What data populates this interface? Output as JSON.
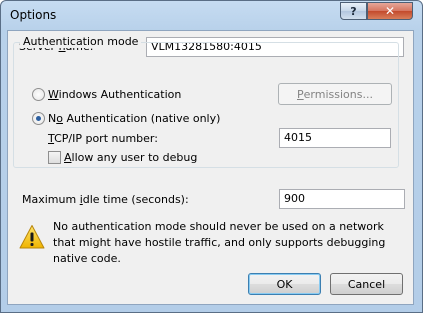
{
  "window": {
    "title": "Options",
    "help_label": "?",
    "close_label": "✕"
  },
  "server": {
    "label_pre": "Server ",
    "label_u": "n",
    "label_post": "ame:",
    "value": "VLM13281580:4015"
  },
  "auth": {
    "group_title": "Authentication mode",
    "windows_auth": {
      "label_u": "W",
      "label_post": "indows Authentication",
      "selected": false
    },
    "permissions_button": {
      "label_u": "P",
      "label_post": "ermissions...",
      "enabled": false
    },
    "no_auth": {
      "label_pre": "N",
      "label_u": "o",
      "label_post": " Authentication (native only)",
      "selected": true
    },
    "port": {
      "label_u": "T",
      "label_post": "CP/IP port number:",
      "value": "4015"
    },
    "allow_any": {
      "label_u": "A",
      "label_post": "llow any user to debug",
      "checked": false
    }
  },
  "idle": {
    "label_pre": "Maximum ",
    "label_u": "i",
    "label_post": "dle time (seconds):",
    "value": "900"
  },
  "warning": {
    "icon": "warning-icon",
    "text": "No authentication mode should never be used on a network that might have hostile traffic, and only supports debugging native code."
  },
  "buttons": {
    "ok": "OK",
    "cancel": "Cancel"
  },
  "colors": {
    "title_gradient_top": "#c6dcf2",
    "client_bg": "#f0f0f0",
    "radio_dot": "#2c5fa0",
    "warning_yellow": "#f3c614"
  }
}
